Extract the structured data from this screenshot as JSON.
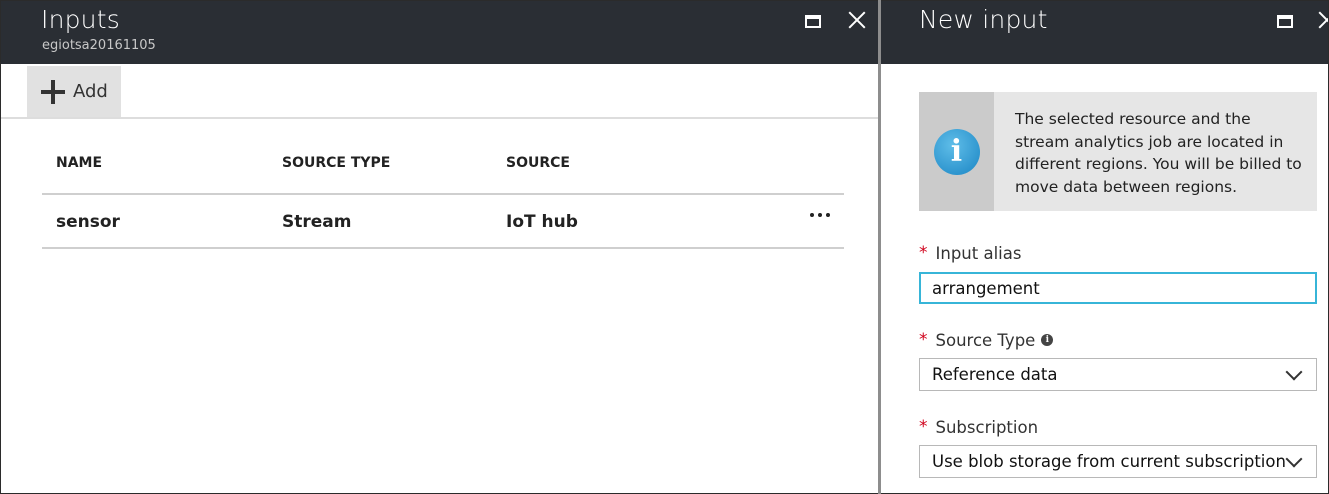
{
  "left_blade": {
    "title": "Inputs",
    "subtitle": "egiotsa20161105",
    "toolbar": {
      "add_label": "Add"
    },
    "table": {
      "columns": [
        "NAME",
        "SOURCE TYPE",
        "SOURCE"
      ],
      "rows": [
        {
          "name": "sensor",
          "source_type": "Stream",
          "source": "IoT hub"
        }
      ]
    }
  },
  "right_blade": {
    "title": "New input",
    "info_text": "The selected resource and the stream analytics job are located in different regions. You will be billed to move data between regions.",
    "fields": {
      "input_alias": {
        "label": "Input alias",
        "value": "arrangement"
      },
      "source_type": {
        "label": "Source Type",
        "value": "Reference data"
      },
      "subscription": {
        "label": "Subscription",
        "value": "Use blob storage from current subscription"
      }
    },
    "required_marker": "*"
  },
  "colors": {
    "header_bg": "#2a2e34",
    "required": "#d0021b",
    "input_focus": "#37b5d8",
    "info_icon": "#1a85c4"
  }
}
